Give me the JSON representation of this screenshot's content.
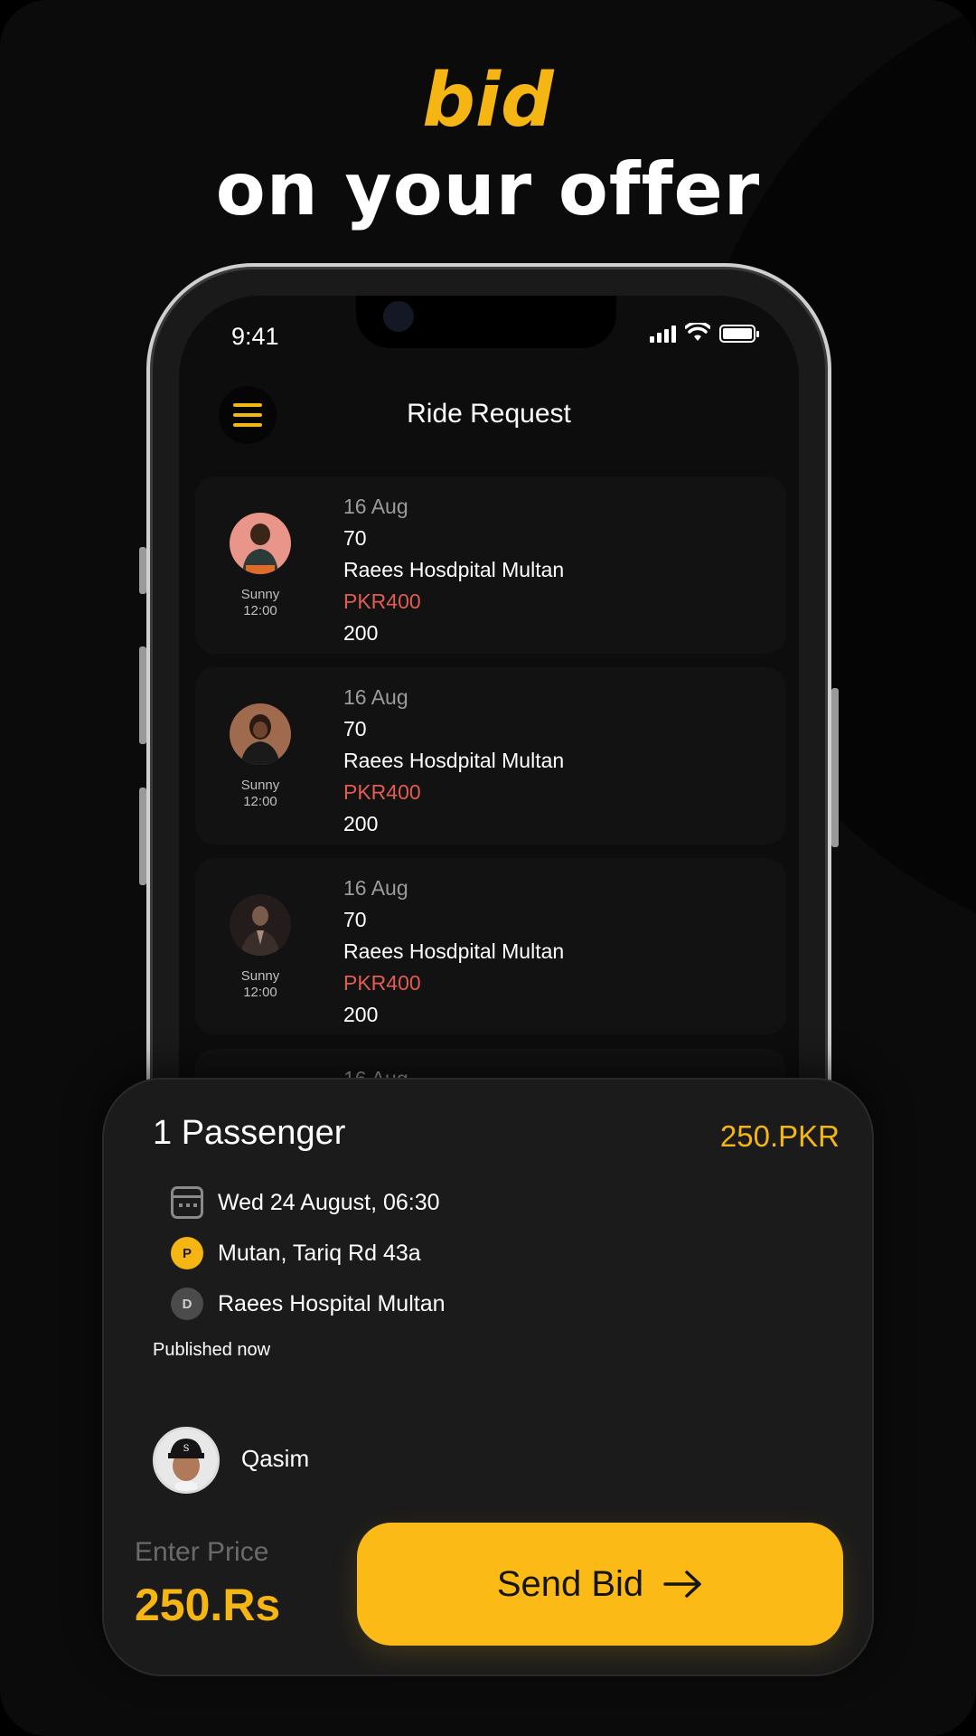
{
  "headline": {
    "accent": "bid",
    "main": "on your offer"
  },
  "status_bar": {
    "time": "9:41",
    "icons": [
      "signal-icon",
      "wifi-icon",
      "battery-icon"
    ]
  },
  "header": {
    "menu_icon": "hamburger-menu-icon",
    "title": "Ride Request"
  },
  "ride_requests": [
    {
      "name": "Sunny",
      "time": "12:00",
      "date": "16 Aug",
      "distance": "70",
      "destination": "Raees Hosdpital Multan",
      "price": "PKR400",
      "amount": "200"
    },
    {
      "name": "Sunny",
      "time": "12:00",
      "date": "16 Aug",
      "distance": "70",
      "destination": "Raees Hosdpital Multan",
      "price": "PKR400",
      "amount": "200"
    },
    {
      "name": "Sunny",
      "time": "12:00",
      "date": "16 Aug",
      "distance": "70",
      "destination": "Raees Hosdpital Multan",
      "price": "PKR400",
      "amount": "200"
    },
    {
      "date": "16 Aug"
    }
  ],
  "offer": {
    "passengers": "1 Passenger",
    "fare": "250.PKR",
    "datetime": "Wed 24 August, 06:30",
    "pickup_badge": "P",
    "pickup": "Mutan, Tariq Rd 43a",
    "dropoff_badge": "D",
    "dropoff": "Raees Hospital Multan",
    "published": "Published now",
    "user_name": "Qasim",
    "enter_price_label": "Enter Price",
    "price_value": "250.Rs",
    "send_button": "Send Bid"
  },
  "colors": {
    "accent": "#f5b614",
    "button": "#fbba16",
    "price_red": "#e25c52",
    "background": "#0b0b0b",
    "sheet": "#1b1b1b"
  }
}
